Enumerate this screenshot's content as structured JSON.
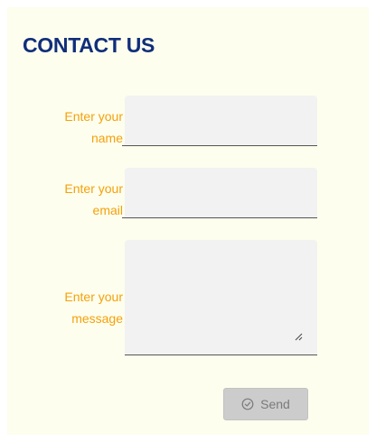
{
  "form": {
    "title": "CONTACT US",
    "fields": [
      {
        "label_line1": "Enter your",
        "label_line2": "name",
        "value": "",
        "placeholder": ""
      },
      {
        "label_line1": "Enter your",
        "label_line2": "email",
        "value": "",
        "placeholder": ""
      },
      {
        "label_line1": "Enter your",
        "label_line2": "message",
        "value": "",
        "placeholder": ""
      }
    ],
    "submit": {
      "label": "Send",
      "icon": "check-circle-icon",
      "disabled": true
    }
  },
  "colors": {
    "background": "#fdfeee",
    "title": "#102e7a",
    "label": "#f5a10a",
    "field_background": "#f2f2f2",
    "button_background": "#cccccc"
  }
}
